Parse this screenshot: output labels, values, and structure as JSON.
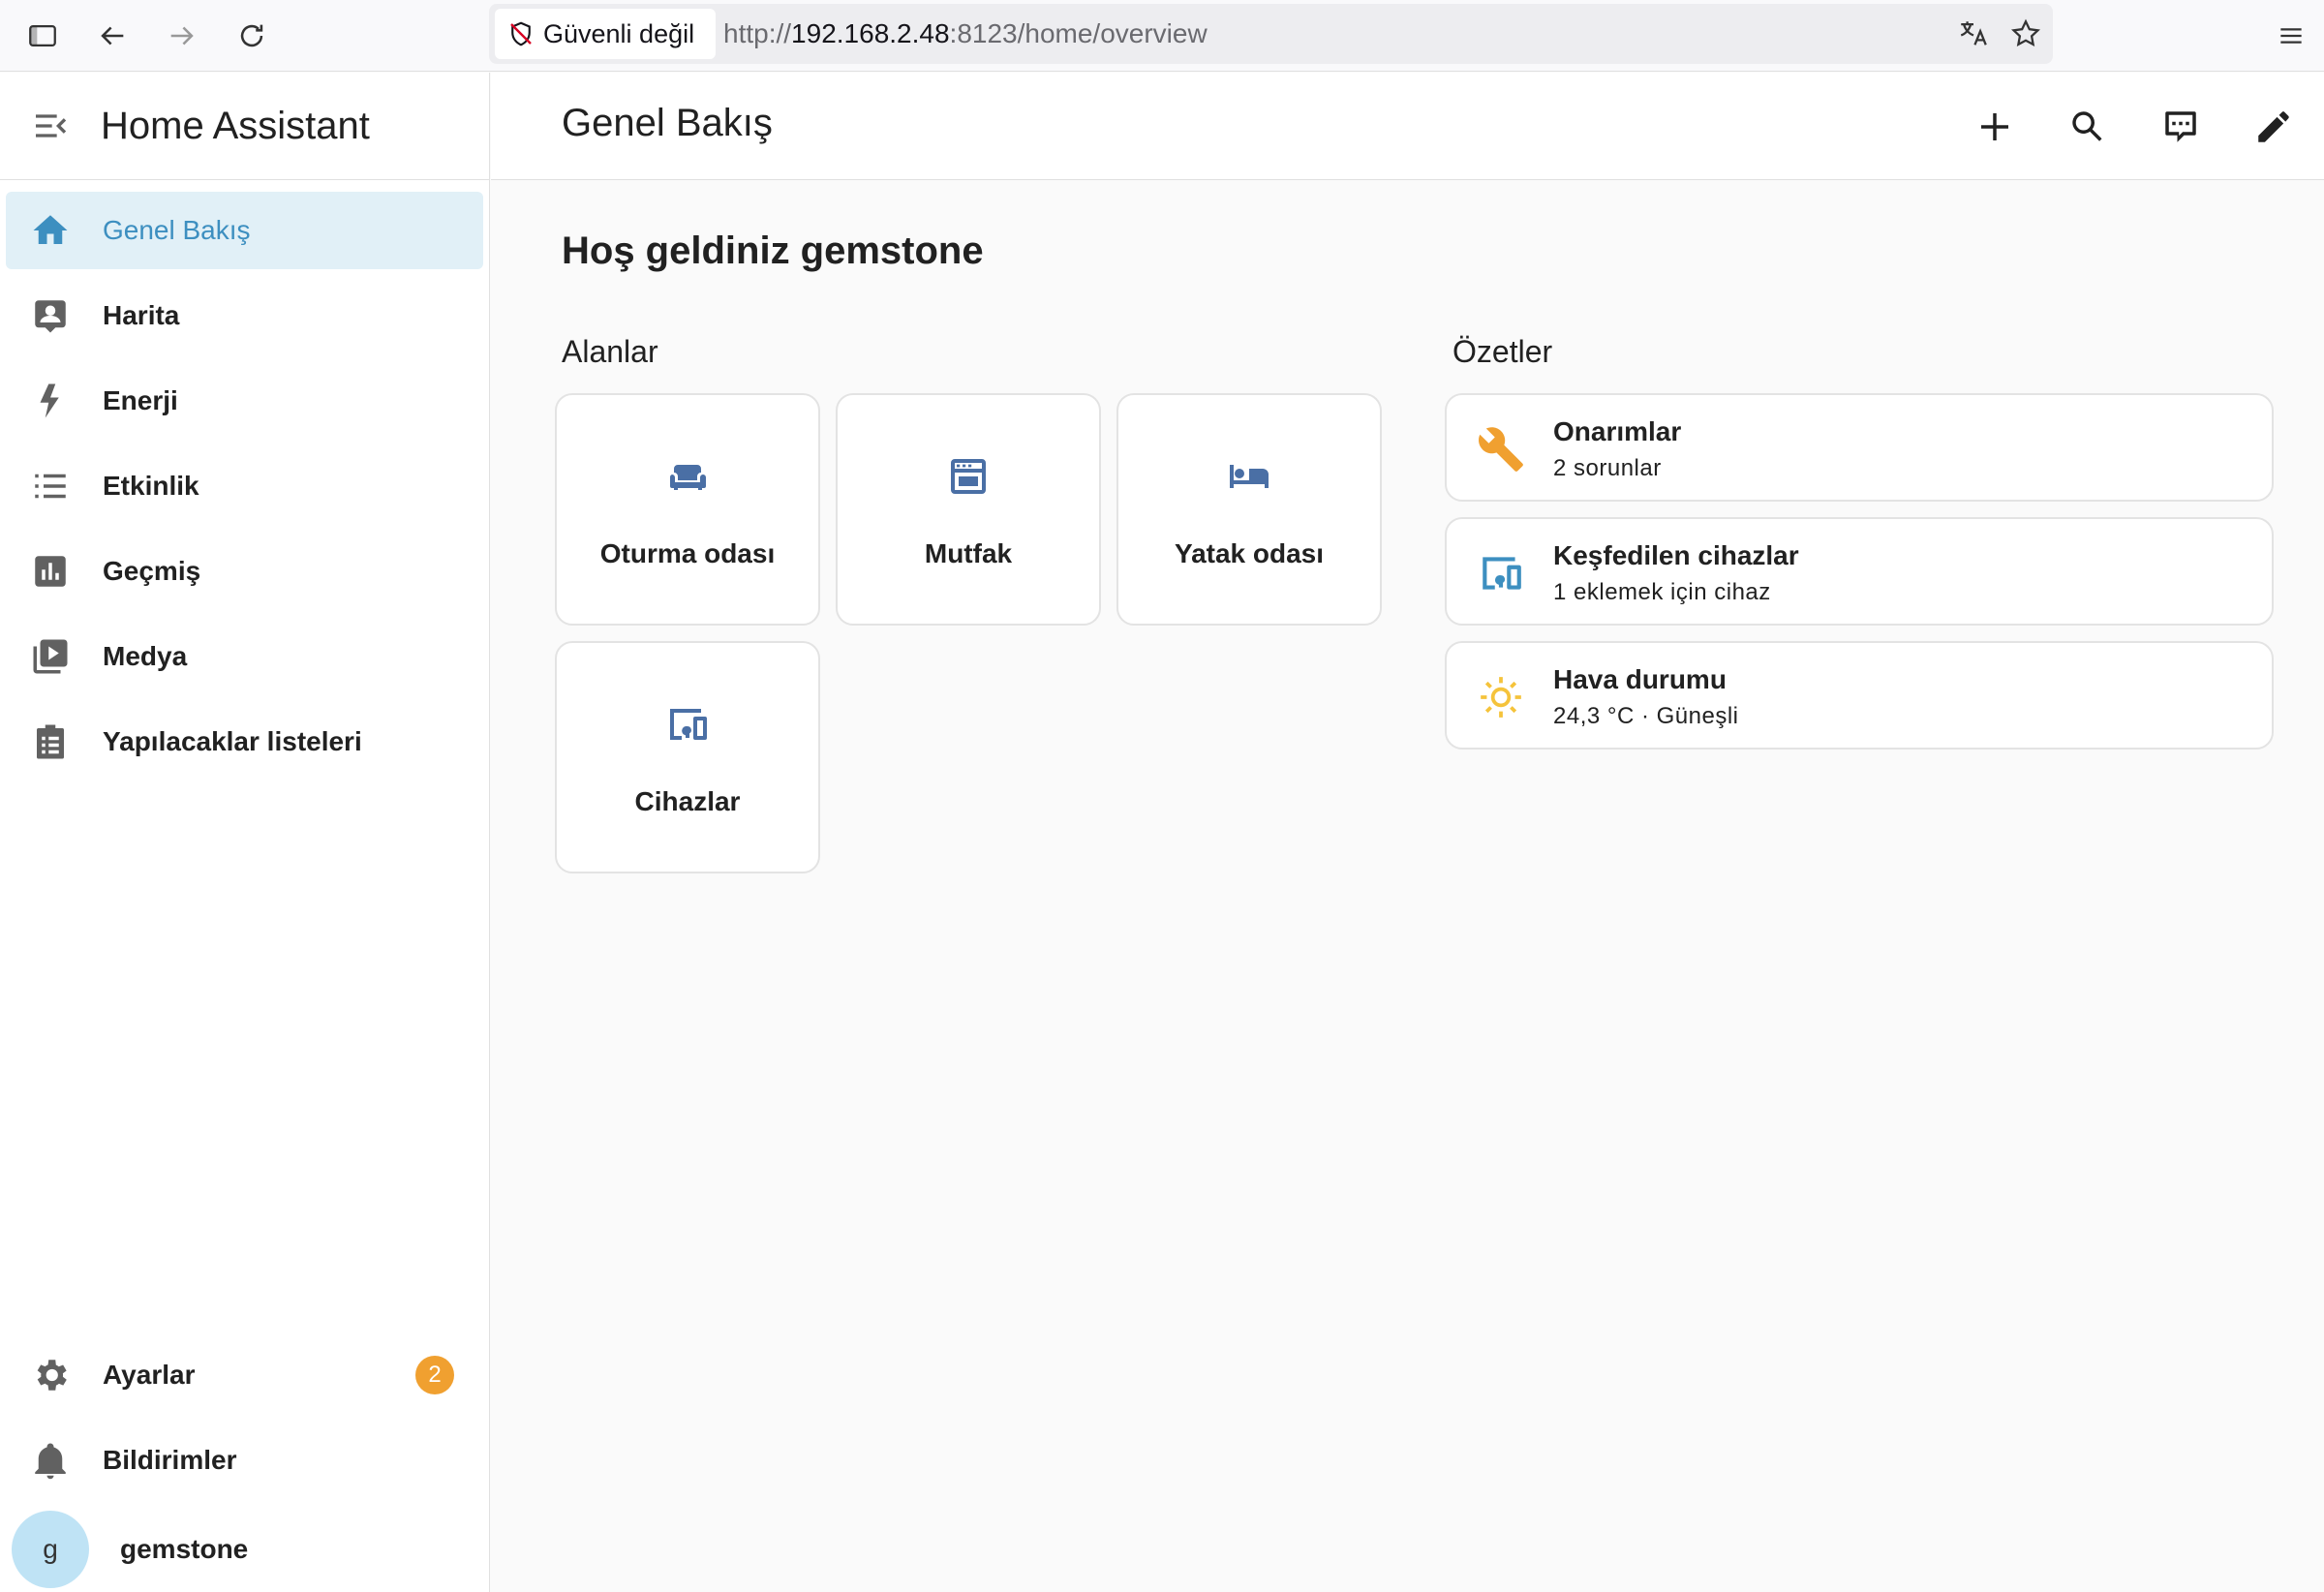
{
  "browser": {
    "security_label": "Güvenli değil",
    "url_scheme": "http://",
    "url_host": "192.168.2.48",
    "url_rest": ":8123/home/overview"
  },
  "sidebar": {
    "title": "Home Assistant",
    "items": [
      {
        "label": "Genel Bakış",
        "icon": "home-icon",
        "active": true
      },
      {
        "label": "Harita",
        "icon": "account-box-icon"
      },
      {
        "label": "Enerji",
        "icon": "lightning-bolt-icon"
      },
      {
        "label": "Etkinlik",
        "icon": "format-list-bulleted-icon"
      },
      {
        "label": "Geçmiş",
        "icon": "chart-box-icon"
      },
      {
        "label": "Medya",
        "icon": "play-box-multiple-icon"
      },
      {
        "label": "Yapılacaklar listeleri",
        "icon": "clipboard-list-icon"
      }
    ],
    "bottom": {
      "settings_label": "Ayarlar",
      "settings_badge": "2",
      "notifications_label": "Bildirimler",
      "user_initial": "g",
      "user_name": "gemstone"
    }
  },
  "header": {
    "title": "Genel Bakış"
  },
  "main": {
    "welcome": "Hoş geldiniz gemstone",
    "areas_title": "Alanlar",
    "summaries_title": "Özetler",
    "areas": [
      {
        "name": "Oturma odası",
        "icon": "sofa-icon"
      },
      {
        "name": "Mutfak",
        "icon": "stove-icon"
      },
      {
        "name": "Yatak odası",
        "icon": "bed-icon"
      },
      {
        "name": "Cihazlar",
        "icon": "devices-icon"
      }
    ],
    "summaries": [
      {
        "title": "Onarımlar",
        "subtitle": "2 sorunlar",
        "icon": "wrench-icon",
        "color": "#f0a030"
      },
      {
        "title": "Keşfedilen cihazlar",
        "subtitle": "1 eklemek için cihaz",
        "icon": "devices-icon",
        "color": "#3d8fc0"
      },
      {
        "title": "Hava durumu",
        "subtitle": "24,3 °C · Güneşli",
        "icon": "sunny-icon",
        "color": "#f5c33b"
      }
    ]
  }
}
